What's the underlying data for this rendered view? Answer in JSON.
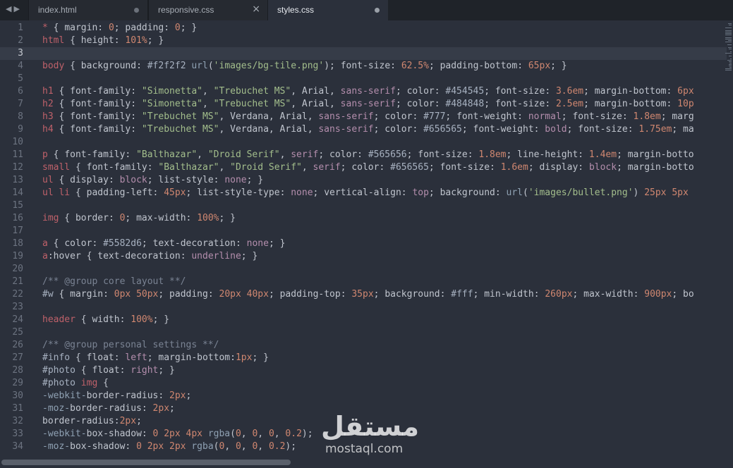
{
  "tabs": [
    {
      "label": "index.html",
      "active": false,
      "modified": true
    },
    {
      "label": "responsive.css",
      "active": false,
      "modified": false,
      "close": "×"
    },
    {
      "label": "styles.css",
      "active": true,
      "modified": true
    }
  ],
  "nav": {
    "back": "◀",
    "forward": "▶"
  },
  "current_line": 3,
  "lines": [
    [
      [
        "sel",
        "*"
      ],
      [
        "punc",
        " { "
      ],
      [
        "prop",
        "margin"
      ],
      [
        "punc",
        ": "
      ],
      [
        "num",
        "0"
      ],
      [
        "punc",
        "; "
      ],
      [
        "prop",
        "padding"
      ],
      [
        "punc",
        ": "
      ],
      [
        "num",
        "0"
      ],
      [
        "punc",
        "; }"
      ]
    ],
    [
      [
        "sel",
        "html"
      ],
      [
        "punc",
        " { "
      ],
      [
        "prop",
        "height"
      ],
      [
        "punc",
        ": "
      ],
      [
        "num",
        "101"
      ],
      [
        "unit",
        "%"
      ],
      [
        "punc",
        "; }"
      ]
    ],
    [],
    [
      [
        "sel",
        "body"
      ],
      [
        "punc",
        " { "
      ],
      [
        "prop",
        "background"
      ],
      [
        "punc",
        ": "
      ],
      [
        "hex",
        "#f2f2f2"
      ],
      [
        "punc",
        " "
      ],
      [
        "fn",
        "url"
      ],
      [
        "punc",
        "("
      ],
      [
        "str",
        "'images/bg-tile.png'"
      ],
      [
        "punc",
        "); "
      ],
      [
        "prop",
        "font-size"
      ],
      [
        "punc",
        ": "
      ],
      [
        "num",
        "62.5"
      ],
      [
        "unit",
        "%"
      ],
      [
        "punc",
        "; "
      ],
      [
        "prop",
        "padding-bottom"
      ],
      [
        "punc",
        ": "
      ],
      [
        "num",
        "65"
      ],
      [
        "unit",
        "px"
      ],
      [
        "punc",
        "; }"
      ]
    ],
    [],
    [
      [
        "sel",
        "h1"
      ],
      [
        "punc",
        " { "
      ],
      [
        "prop",
        "font-family"
      ],
      [
        "punc",
        ": "
      ],
      [
        "str",
        "\"Simonetta\""
      ],
      [
        "punc",
        ", "
      ],
      [
        "str",
        "\"Trebuchet MS\""
      ],
      [
        "punc",
        ", Arial, "
      ],
      [
        "kw",
        "sans-serif"
      ],
      [
        "punc",
        "; "
      ],
      [
        "prop",
        "color"
      ],
      [
        "punc",
        ": "
      ],
      [
        "hex",
        "#454545"
      ],
      [
        "punc",
        "; "
      ],
      [
        "prop",
        "font-size"
      ],
      [
        "punc",
        ": "
      ],
      [
        "num",
        "3.6"
      ],
      [
        "unit",
        "em"
      ],
      [
        "punc",
        "; "
      ],
      [
        "prop",
        "margin-bottom"
      ],
      [
        "punc",
        ": "
      ],
      [
        "num",
        "6"
      ],
      [
        "unit",
        "px"
      ]
    ],
    [
      [
        "sel",
        "h2"
      ],
      [
        "punc",
        " { "
      ],
      [
        "prop",
        "font-family"
      ],
      [
        "punc",
        ": "
      ],
      [
        "str",
        "\"Simonetta\""
      ],
      [
        "punc",
        ", "
      ],
      [
        "str",
        "\"Trebuchet MS\""
      ],
      [
        "punc",
        ", Arial, "
      ],
      [
        "kw",
        "sans-serif"
      ],
      [
        "punc",
        "; "
      ],
      [
        "prop",
        "color"
      ],
      [
        "punc",
        ": "
      ],
      [
        "hex",
        "#484848"
      ],
      [
        "punc",
        "; "
      ],
      [
        "prop",
        "font-size"
      ],
      [
        "punc",
        ": "
      ],
      [
        "num",
        "2.5"
      ],
      [
        "unit",
        "em"
      ],
      [
        "punc",
        "; "
      ],
      [
        "prop",
        "margin-bottom"
      ],
      [
        "punc",
        ": "
      ],
      [
        "num",
        "10"
      ],
      [
        "unit",
        "p"
      ]
    ],
    [
      [
        "sel",
        "h3"
      ],
      [
        "punc",
        " { "
      ],
      [
        "prop",
        "font-family"
      ],
      [
        "punc",
        ": "
      ],
      [
        "str",
        "\"Trebuchet MS\""
      ],
      [
        "punc",
        ", Verdana, Arial, "
      ],
      [
        "kw",
        "sans-serif"
      ],
      [
        "punc",
        "; "
      ],
      [
        "prop",
        "color"
      ],
      [
        "punc",
        ": "
      ],
      [
        "hex",
        "#777"
      ],
      [
        "punc",
        "; "
      ],
      [
        "prop",
        "font-weight"
      ],
      [
        "punc",
        ": "
      ],
      [
        "kw",
        "normal"
      ],
      [
        "punc",
        "; "
      ],
      [
        "prop",
        "font-size"
      ],
      [
        "punc",
        ": "
      ],
      [
        "num",
        "1.8"
      ],
      [
        "unit",
        "em"
      ],
      [
        "punc",
        "; "
      ],
      [
        "prop",
        "marg"
      ]
    ],
    [
      [
        "sel",
        "h4"
      ],
      [
        "punc",
        " { "
      ],
      [
        "prop",
        "font-family"
      ],
      [
        "punc",
        ": "
      ],
      [
        "str",
        "\"Trebuchet MS\""
      ],
      [
        "punc",
        ", Verdana, Arial, "
      ],
      [
        "kw",
        "sans-serif"
      ],
      [
        "punc",
        "; "
      ],
      [
        "prop",
        "color"
      ],
      [
        "punc",
        ": "
      ],
      [
        "hex",
        "#656565"
      ],
      [
        "punc",
        "; "
      ],
      [
        "prop",
        "font-weight"
      ],
      [
        "punc",
        ": "
      ],
      [
        "kw",
        "bold"
      ],
      [
        "punc",
        "; "
      ],
      [
        "prop",
        "font-size"
      ],
      [
        "punc",
        ": "
      ],
      [
        "num",
        "1.75"
      ],
      [
        "unit",
        "em"
      ],
      [
        "punc",
        "; "
      ],
      [
        "prop",
        "ma"
      ]
    ],
    [],
    [
      [
        "sel",
        "p"
      ],
      [
        "punc",
        " { "
      ],
      [
        "prop",
        "font-family"
      ],
      [
        "punc",
        ": "
      ],
      [
        "str",
        "\"Balthazar\""
      ],
      [
        "punc",
        ", "
      ],
      [
        "str",
        "\"Droid Serif\""
      ],
      [
        "punc",
        ", "
      ],
      [
        "kw",
        "serif"
      ],
      [
        "punc",
        "; "
      ],
      [
        "prop",
        "color"
      ],
      [
        "punc",
        ": "
      ],
      [
        "hex",
        "#565656"
      ],
      [
        "punc",
        "; "
      ],
      [
        "prop",
        "font-size"
      ],
      [
        "punc",
        ": "
      ],
      [
        "num",
        "1.8"
      ],
      [
        "unit",
        "em"
      ],
      [
        "punc",
        "; "
      ],
      [
        "prop",
        "line-height"
      ],
      [
        "punc",
        ": "
      ],
      [
        "num",
        "1.4"
      ],
      [
        "unit",
        "em"
      ],
      [
        "punc",
        "; "
      ],
      [
        "prop",
        "margin-botto"
      ]
    ],
    [
      [
        "sel",
        "small"
      ],
      [
        "punc",
        " { "
      ],
      [
        "prop",
        "font-family"
      ],
      [
        "punc",
        ": "
      ],
      [
        "str",
        "\"Balthazar\""
      ],
      [
        "punc",
        ", "
      ],
      [
        "str",
        "\"Droid Serif\""
      ],
      [
        "punc",
        ", "
      ],
      [
        "kw",
        "serif"
      ],
      [
        "punc",
        "; "
      ],
      [
        "prop",
        "color"
      ],
      [
        "punc",
        ": "
      ],
      [
        "hex",
        "#656565"
      ],
      [
        "punc",
        "; "
      ],
      [
        "prop",
        "font-size"
      ],
      [
        "punc",
        ": "
      ],
      [
        "num",
        "1.6"
      ],
      [
        "unit",
        "em"
      ],
      [
        "punc",
        "; "
      ],
      [
        "prop",
        "display"
      ],
      [
        "punc",
        ": "
      ],
      [
        "kw",
        "block"
      ],
      [
        "punc",
        "; "
      ],
      [
        "prop",
        "margin-botto"
      ]
    ],
    [
      [
        "sel",
        "ul"
      ],
      [
        "punc",
        " { "
      ],
      [
        "prop",
        "display"
      ],
      [
        "punc",
        ": "
      ],
      [
        "kw",
        "block"
      ],
      [
        "punc",
        "; "
      ],
      [
        "prop",
        "list-style"
      ],
      [
        "punc",
        ": "
      ],
      [
        "kw",
        "none"
      ],
      [
        "punc",
        "; }"
      ]
    ],
    [
      [
        "sel",
        "ul li"
      ],
      [
        "punc",
        " { "
      ],
      [
        "prop",
        "padding-left"
      ],
      [
        "punc",
        ": "
      ],
      [
        "num",
        "45"
      ],
      [
        "unit",
        "px"
      ],
      [
        "punc",
        "; "
      ],
      [
        "prop",
        "list-style-type"
      ],
      [
        "punc",
        ": "
      ],
      [
        "kw",
        "none"
      ],
      [
        "punc",
        "; "
      ],
      [
        "prop",
        "vertical-align"
      ],
      [
        "punc",
        ": "
      ],
      [
        "kw",
        "top"
      ],
      [
        "punc",
        "; "
      ],
      [
        "prop",
        "background"
      ],
      [
        "punc",
        ": "
      ],
      [
        "fn",
        "url"
      ],
      [
        "punc",
        "("
      ],
      [
        "str",
        "'images/bullet.png'"
      ],
      [
        "punc",
        ") "
      ],
      [
        "num",
        "25"
      ],
      [
        "unit",
        "px"
      ],
      [
        "punc",
        " "
      ],
      [
        "num",
        "5"
      ],
      [
        "unit",
        "px"
      ]
    ],
    [],
    [
      [
        "sel",
        "img"
      ],
      [
        "punc",
        " { "
      ],
      [
        "prop",
        "border"
      ],
      [
        "punc",
        ": "
      ],
      [
        "num",
        "0"
      ],
      [
        "punc",
        "; "
      ],
      [
        "prop",
        "max-width"
      ],
      [
        "punc",
        ": "
      ],
      [
        "num",
        "100"
      ],
      [
        "unit",
        "%"
      ],
      [
        "punc",
        "; }"
      ]
    ],
    [],
    [
      [
        "sel",
        "a"
      ],
      [
        "punc",
        " { "
      ],
      [
        "prop",
        "color"
      ],
      [
        "punc",
        ": "
      ],
      [
        "hex",
        "#5582d6"
      ],
      [
        "punc",
        "; "
      ],
      [
        "prop",
        "text-decoration"
      ],
      [
        "punc",
        ": "
      ],
      [
        "kw",
        "none"
      ],
      [
        "punc",
        "; }"
      ]
    ],
    [
      [
        "sel",
        "a"
      ],
      [
        "pseudo",
        ":hover"
      ],
      [
        "punc",
        " { "
      ],
      [
        "prop",
        "text-decoration"
      ],
      [
        "punc",
        ": "
      ],
      [
        "kw",
        "underline"
      ],
      [
        "punc",
        "; }"
      ]
    ],
    [],
    [
      [
        "cmt",
        "/** @group core layout **/"
      ]
    ],
    [
      [
        "hex",
        "#w"
      ],
      [
        "punc",
        " { "
      ],
      [
        "prop",
        "margin"
      ],
      [
        "punc",
        ": "
      ],
      [
        "num",
        "0"
      ],
      [
        "unit",
        "px"
      ],
      [
        "punc",
        " "
      ],
      [
        "num",
        "50"
      ],
      [
        "unit",
        "px"
      ],
      [
        "punc",
        "; "
      ],
      [
        "prop",
        "padding"
      ],
      [
        "punc",
        ": "
      ],
      [
        "num",
        "20"
      ],
      [
        "unit",
        "px"
      ],
      [
        "punc",
        " "
      ],
      [
        "num",
        "40"
      ],
      [
        "unit",
        "px"
      ],
      [
        "punc",
        "; "
      ],
      [
        "prop",
        "padding-top"
      ],
      [
        "punc",
        ": "
      ],
      [
        "num",
        "35"
      ],
      [
        "unit",
        "px"
      ],
      [
        "punc",
        "; "
      ],
      [
        "prop",
        "background"
      ],
      [
        "punc",
        ": "
      ],
      [
        "hex",
        "#fff"
      ],
      [
        "punc",
        "; "
      ],
      [
        "prop",
        "min-width"
      ],
      [
        "punc",
        ": "
      ],
      [
        "num",
        "260"
      ],
      [
        "unit",
        "px"
      ],
      [
        "punc",
        "; "
      ],
      [
        "prop",
        "max-width"
      ],
      [
        "punc",
        ": "
      ],
      [
        "num",
        "900"
      ],
      [
        "unit",
        "px"
      ],
      [
        "punc",
        "; "
      ],
      [
        "prop",
        "bo"
      ]
    ],
    [],
    [
      [
        "sel",
        "header"
      ],
      [
        "punc",
        " { "
      ],
      [
        "prop",
        "width"
      ],
      [
        "punc",
        ": "
      ],
      [
        "num",
        "100"
      ],
      [
        "unit",
        "%"
      ],
      [
        "punc",
        "; }"
      ]
    ],
    [],
    [
      [
        "cmt",
        "/** @group personal settings **/"
      ]
    ],
    [
      [
        "hex",
        "#info"
      ],
      [
        "punc",
        " { "
      ],
      [
        "prop",
        "float"
      ],
      [
        "punc",
        ": "
      ],
      [
        "kw",
        "left"
      ],
      [
        "punc",
        "; "
      ],
      [
        "prop",
        "margin-bottom"
      ],
      [
        "punc",
        ":"
      ],
      [
        "num",
        "1"
      ],
      [
        "unit",
        "px"
      ],
      [
        "punc",
        "; }"
      ]
    ],
    [
      [
        "hex",
        "#photo"
      ],
      [
        "punc",
        " { "
      ],
      [
        "prop",
        "float"
      ],
      [
        "punc",
        ": "
      ],
      [
        "kw",
        "right"
      ],
      [
        "punc",
        "; }"
      ]
    ],
    [
      [
        "hex",
        "#photo"
      ],
      [
        "punc",
        " "
      ],
      [
        "sel",
        "img"
      ],
      [
        "punc",
        " {"
      ]
    ],
    [
      [
        "vendor",
        "-webkit-"
      ],
      [
        "punc",
        "border-radius: "
      ],
      [
        "num",
        "2"
      ],
      [
        "unit",
        "px"
      ],
      [
        "punc",
        ";"
      ]
    ],
    [
      [
        "vendor",
        "-moz-"
      ],
      [
        "punc",
        "border-radius: "
      ],
      [
        "num",
        "2"
      ],
      [
        "unit",
        "px"
      ],
      [
        "punc",
        ";"
      ]
    ],
    [
      [
        "punc",
        "border-radius:"
      ],
      [
        "num",
        "2"
      ],
      [
        "unit",
        "px"
      ],
      [
        "punc",
        ";"
      ]
    ],
    [
      [
        "vendor",
        "-webkit-"
      ],
      [
        "punc",
        "box-shadow: "
      ],
      [
        "num",
        "0"
      ],
      [
        "punc",
        " "
      ],
      [
        "num",
        "2"
      ],
      [
        "unit",
        "px"
      ],
      [
        "punc",
        " "
      ],
      [
        "num",
        "4"
      ],
      [
        "unit",
        "px"
      ],
      [
        "punc",
        " "
      ],
      [
        "fn",
        "rgba"
      ],
      [
        "punc",
        "("
      ],
      [
        "num",
        "0"
      ],
      [
        "punc",
        ", "
      ],
      [
        "num",
        "0"
      ],
      [
        "punc",
        ", "
      ],
      [
        "num",
        "0"
      ],
      [
        "punc",
        ", "
      ],
      [
        "num",
        "0.2"
      ],
      [
        "punc",
        ");"
      ]
    ],
    [
      [
        "vendor",
        "-moz-"
      ],
      [
        "punc",
        "box-shadow: "
      ],
      [
        "num",
        "0"
      ],
      [
        "punc",
        " "
      ],
      [
        "num",
        "2"
      ],
      [
        "unit",
        "px"
      ],
      [
        "punc",
        " "
      ],
      [
        "num",
        "2"
      ],
      [
        "unit",
        "px"
      ],
      [
        "punc",
        " "
      ],
      [
        "fn",
        "rgba"
      ],
      [
        "punc",
        "("
      ],
      [
        "num",
        "0"
      ],
      [
        "punc",
        ", "
      ],
      [
        "num",
        "0"
      ],
      [
        "punc",
        ", "
      ],
      [
        "num",
        "0"
      ],
      [
        "punc",
        ", "
      ],
      [
        "num",
        "0.2"
      ],
      [
        "punc",
        ");"
      ]
    ]
  ],
  "watermark": {
    "arabic": "مستقل",
    "latin": "mostaql.com"
  }
}
